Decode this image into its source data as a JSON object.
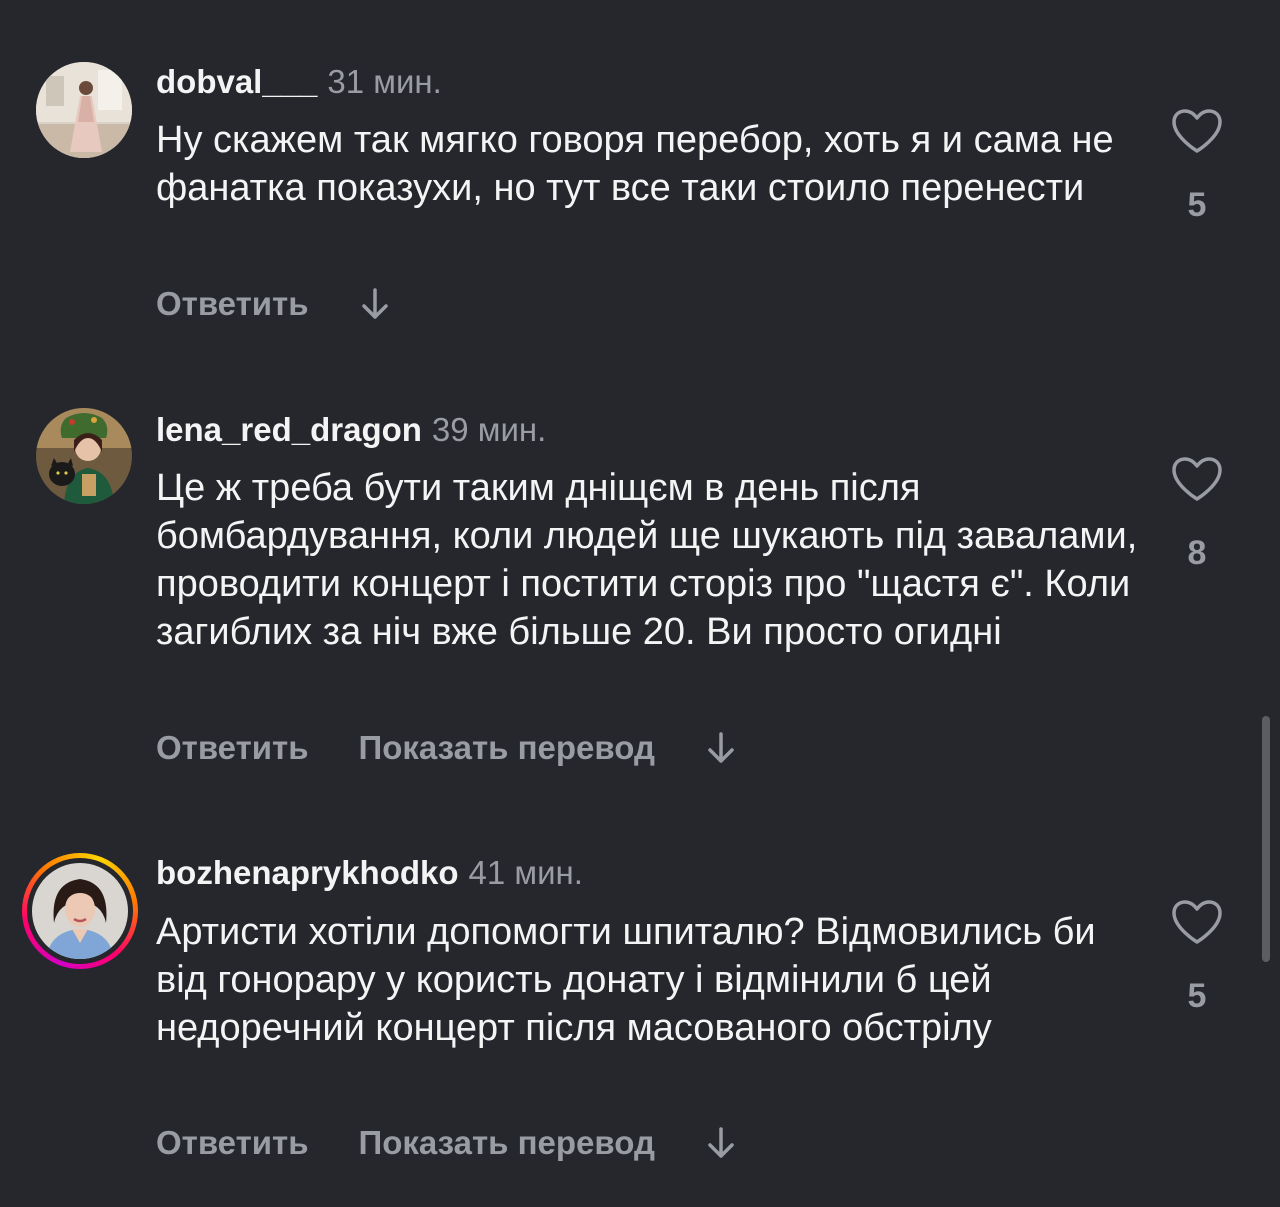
{
  "comments": [
    {
      "username": "dobval___",
      "time": "31 мин.",
      "text": "Ну скажем так мягко говоря перебор, хоть я и сама не фанатка показухи, но тут все таки стоило перенести",
      "likes": "5",
      "reply_label": "Ответить",
      "translate_label": null,
      "avatar": "photo-woman-in-dress"
    },
    {
      "username": "lena_red_dragon",
      "time": "39 мин.",
      "text": "Це ж треба бути таким дніщєм в день після бомбардування, коли людей ще шукають під завалами, проводити концерт і постити сторіз про \"щастя є\". Коли загиблих за ніч вже більше 20. Ви просто огидні",
      "likes": "8",
      "reply_label": "Ответить",
      "translate_label": "Показать перевод",
      "avatar": "photo-woman-with-cat-and-wreath"
    },
    {
      "username": "bozhenaprykhodko",
      "time": "41 мин.",
      "text": "Артисти хотіли допомогти шпиталю? Відмовились би від гонорару у користь донату і відмінили б цей недоречний концерт після масованого обстрілу",
      "likes": "5",
      "reply_label": "Ответить",
      "translate_label": "Показать перевод",
      "avatar": "photo-woman-portrait-story-ring"
    }
  ],
  "icons": {
    "like": "heart-outline-icon",
    "more": "arrow-down-icon"
  },
  "colors": {
    "background": "#25272d",
    "text_primary": "#f4f4f5",
    "text_secondary": "#9a9ca3",
    "story_ring": "#ff0069"
  }
}
